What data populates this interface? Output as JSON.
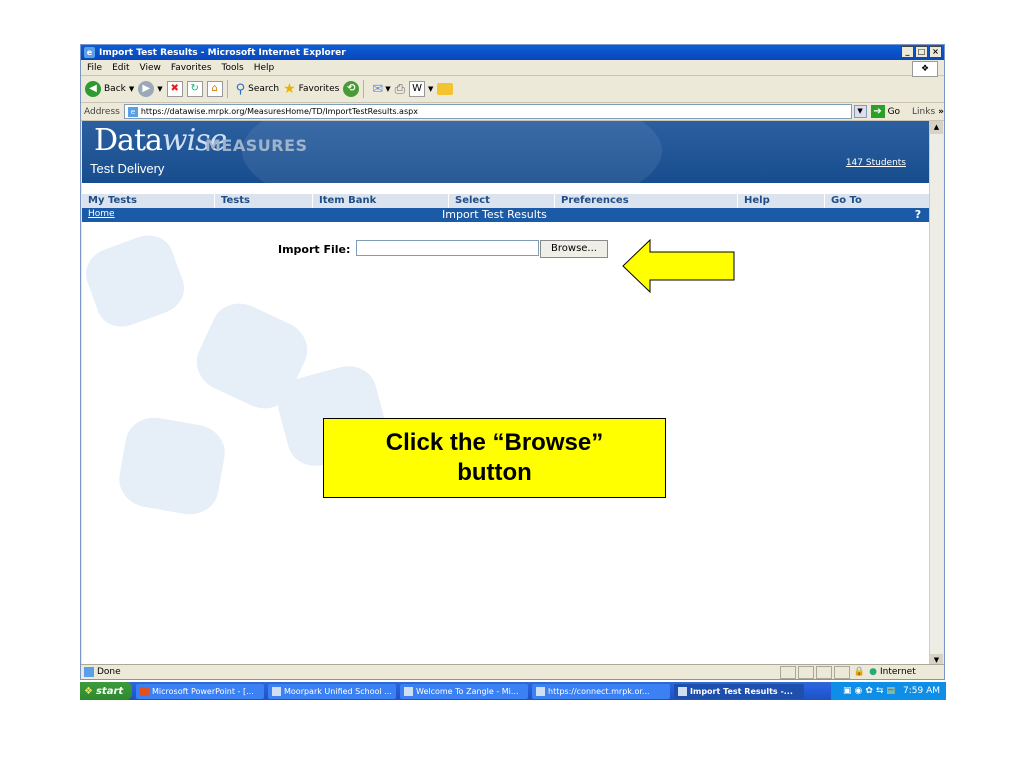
{
  "window": {
    "title": "Import Test Results - Microsoft Internet Explorer"
  },
  "menu": [
    "File",
    "Edit",
    "View",
    "Favorites",
    "Tools",
    "Help"
  ],
  "toolbar": {
    "back": "Back",
    "search": "Search",
    "favorites": "Favorites"
  },
  "address": {
    "label": "Address",
    "url": "https://datawise.mrpk.org/MeasuresHome/TD/ImportTestResults.aspx",
    "go": "Go",
    "links": "Links"
  },
  "logo": {
    "data": "Data",
    "wise": "wise",
    "measures": "MEASURES",
    "sub": "Test Delivery"
  },
  "students_link": "147 Students",
  "nav": [
    "My Tests",
    "Tests",
    "Item Bank",
    "Select",
    "Preferences",
    "Help",
    "Go To"
  ],
  "breadcrumb": {
    "home": "Home",
    "title": "Import Test Results"
  },
  "form": {
    "label": "Import File:",
    "value": "",
    "browse": "Browse..."
  },
  "status": {
    "text": "Done",
    "zone": "Internet"
  },
  "taskbar": {
    "start": "start",
    "tasks": [
      "Microsoft PowerPoint - [...",
      "Moorpark Unified School ...",
      "Welcome To Zangle - Mi...",
      "https://connect.mrpk.or...",
      "Import Test Results -..."
    ],
    "time": "7:59 AM"
  },
  "callout": {
    "line1": "Click the “Browse”",
    "line2": "button"
  },
  "colors": {
    "callout_bg": "#ffff00",
    "banner": "#1f5596",
    "taskbar": "#245edb"
  }
}
